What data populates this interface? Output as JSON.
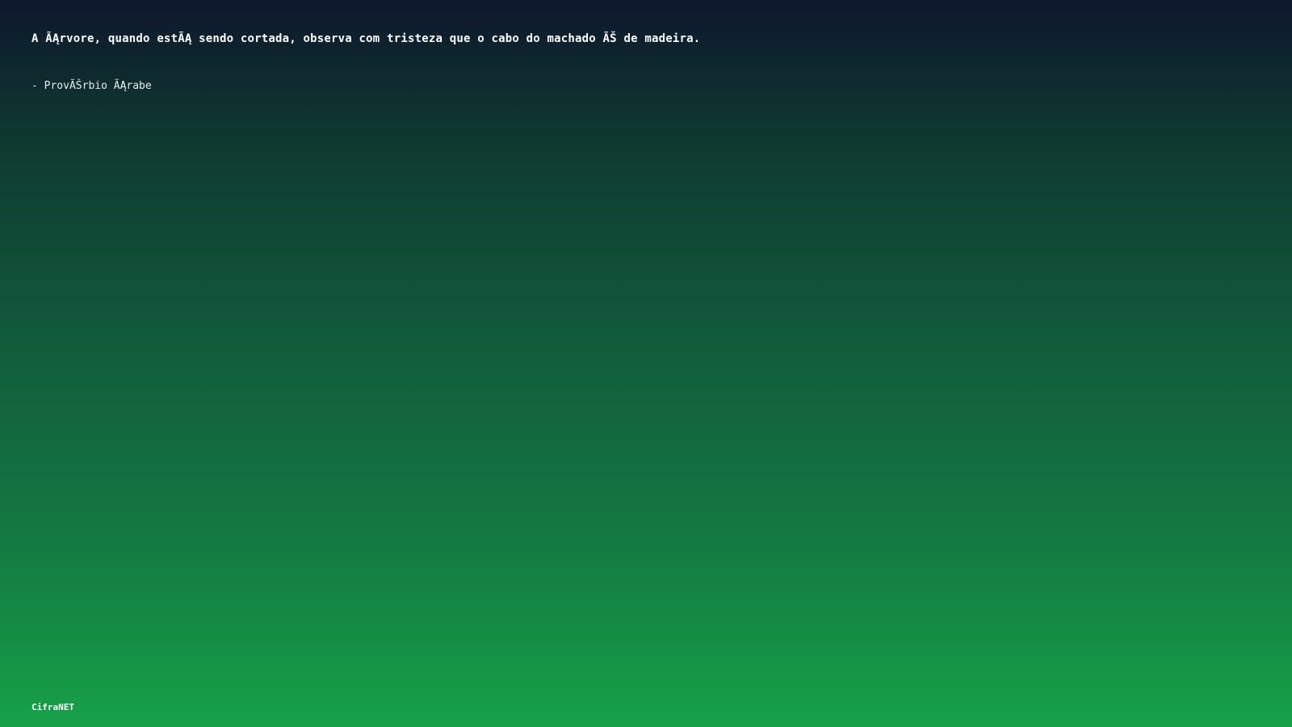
{
  "quote": {
    "text": "A ÃĄrvore, quando estÃĄ sendo cortada, observa com tristeza que o cabo do machado ÃŠ de madeira.",
    "author": "- ProvÃŠrbio ÃĄrabe"
  },
  "footer": {
    "brand": "CifraNET"
  },
  "colors": {
    "gradient_top": "#0e172d",
    "gradient_bottom": "#16a148",
    "text": "#ffffff"
  }
}
